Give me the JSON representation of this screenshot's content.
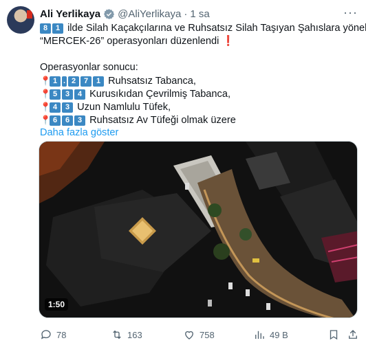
{
  "author": {
    "name": "Ali Yerlikaya",
    "handle": "@AliYerlikaya",
    "dot": "·",
    "time": "1 sa"
  },
  "more_label": "···",
  "tweet": {
    "line1": {
      "keycaps": [
        "8",
        "1"
      ],
      "text": "ilde Silah Kaçakçılarına ve Ruhsatsız Silah Taşıyan Şahıslara yönelik"
    },
    "line2": {
      "text": "“MERCEK-26” operasyonları düzenlendi",
      "mark": "❗"
    },
    "results_title": "Operasyonlar sonucu:",
    "items": [
      {
        "keycaps": [
          "1",
          ".",
          "2",
          "7",
          "1"
        ],
        "text": "Ruhsatsız Tabanca,"
      },
      {
        "keycaps": [
          "5",
          "3",
          "4"
        ],
        "text": "Kurusıkıdan Çevrilmiş Tabanca,"
      },
      {
        "keycaps": [
          "4",
          "3"
        ],
        "text": "Uzun Namlulu Tüfek,"
      },
      {
        "keycaps": [
          "6",
          "6",
          "3"
        ],
        "text": "Ruhsatsız Av Tüfeği olmak üzere"
      }
    ],
    "show_more": "Daha fazla göster"
  },
  "video": {
    "duration": "1:50"
  },
  "stats": {
    "replies": "78",
    "reposts": "163",
    "likes": "758",
    "views": "49 B"
  },
  "colors": {
    "accent": "#1d9bf0",
    "keycap": "#3b88c3",
    "muted": "#536471"
  }
}
